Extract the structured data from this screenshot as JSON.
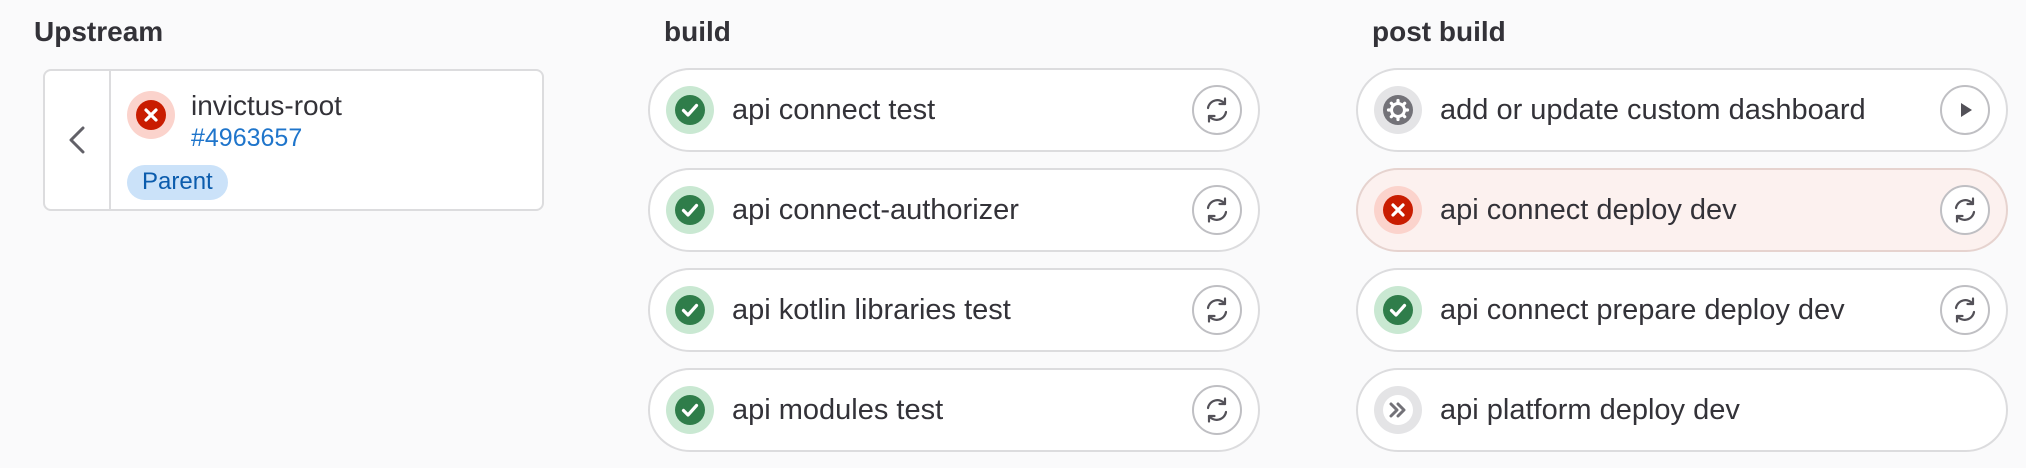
{
  "stages": {
    "upstream": {
      "title": "Upstream"
    },
    "build": {
      "title": "build"
    },
    "post_build": {
      "title": "post build"
    }
  },
  "upstream": {
    "name": "invictus-root",
    "pipeline_id": "#4963657",
    "badge": "Parent",
    "status": "failed"
  },
  "build": {
    "jobs": [
      {
        "name": "api connect test",
        "status": "success",
        "action": "retry"
      },
      {
        "name": "api connect-authorizer",
        "status": "success",
        "action": "retry"
      },
      {
        "name": "api kotlin libraries test",
        "status": "success",
        "action": "retry"
      },
      {
        "name": "api modules test",
        "status": "success",
        "action": "retry"
      }
    ]
  },
  "post_build": {
    "jobs": [
      {
        "name": "add or update custom dashboard",
        "status": "manual",
        "action": "play"
      },
      {
        "name": "api connect deploy dev",
        "status": "failed",
        "action": "retry"
      },
      {
        "name": "api connect prepare deploy dev",
        "status": "success",
        "action": "retry"
      },
      {
        "name": "api platform deploy dev",
        "status": "skipped",
        "action": "none"
      }
    ]
  },
  "colors": {
    "success": "#2f7d4a",
    "success_halo": "#c9e8d2",
    "failed": "#dd2b0e",
    "failed_halo": "#fbd3cc",
    "neutral": "#737278",
    "neutral_halo": "#e4e4e6",
    "link": "#1f75cb"
  }
}
